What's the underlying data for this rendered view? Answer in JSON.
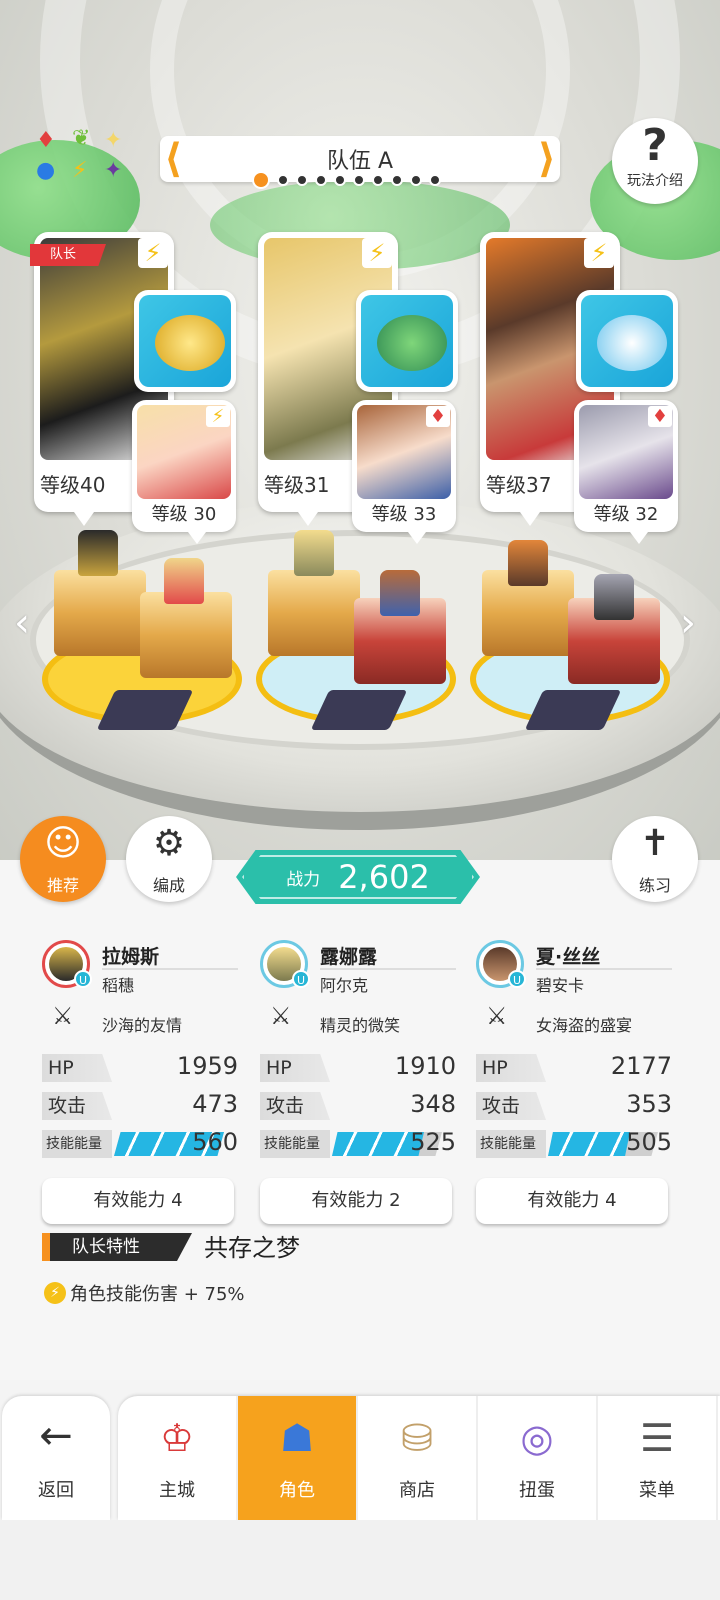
{
  "team": {
    "title": "队伍 A",
    "page_count": 10,
    "active_page": 1
  },
  "help": {
    "label": "玩法介绍",
    "icon": "question-mark-icon"
  },
  "leader_tag": "队长",
  "cards": [
    {
      "level": "等级40",
      "sub_level": "等级 30"
    },
    {
      "level": "等级31",
      "sub_level": "等级 33"
    },
    {
      "level": "等级37",
      "sub_level": "等级 32"
    }
  ],
  "buttons": {
    "recommend": "推荐",
    "formation": "编成",
    "practice": "练习"
  },
  "power": {
    "label": "战力",
    "value": "2,602"
  },
  "members": [
    {
      "name": "拉姆斯",
      "sub": "稻穗",
      "weapon": "沙海的友情",
      "hp": "1959",
      "atk": "473",
      "energy": "560",
      "ability": "有效能力 4"
    },
    {
      "name": "露娜露",
      "sub": "阿尔克",
      "weapon": "精灵的微笑",
      "hp": "1910",
      "atk": "348",
      "energy": "525",
      "ability": "有效能力 2"
    },
    {
      "name": "夏·丝丝",
      "sub": "碧安卡",
      "weapon": "女海盗的盛宴",
      "hp": "2177",
      "atk": "353",
      "energy": "505",
      "ability": "有效能力 4"
    }
  ],
  "stat_labels": {
    "hp": "HP",
    "atk": "攻击",
    "energy": "技能能量"
  },
  "leader_skill": {
    "label": "队长特性",
    "name": "共存之梦",
    "effect": "角色技能伤害 + 75%"
  },
  "nav": {
    "back": "返回",
    "items": [
      {
        "label": "主城",
        "icon": "town-icon"
      },
      {
        "label": "角色",
        "icon": "character-icon"
      },
      {
        "label": "商店",
        "icon": "shop-icon"
      },
      {
        "label": "扭蛋",
        "icon": "gacha-icon"
      },
      {
        "label": "菜单",
        "icon": "menu-icon"
      }
    ],
    "active": "角色"
  },
  "colors": {
    "accent": "#f6911f",
    "power": "#2bbfaa",
    "energy": "#25b6e3"
  }
}
